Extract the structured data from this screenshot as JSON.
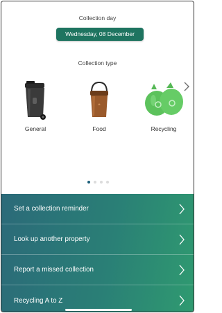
{
  "collection_day": {
    "label": "Collection day",
    "date": "Wednesday, 08 December"
  },
  "collection_type": {
    "label": "Collection type",
    "items": [
      {
        "label": "General",
        "icon": "general-waste-bin-icon",
        "color": "#3b3b3b"
      },
      {
        "label": "Food",
        "icon": "food-caddy-icon",
        "color": "#9a5a2b"
      },
      {
        "label": "Recycling",
        "icon": "recycling-bag-icon",
        "color": "#5cc25c"
      }
    ],
    "page_count": 4,
    "active_page": 1
  },
  "menu": {
    "items": [
      {
        "label": "Set a collection reminder"
      },
      {
        "label": "Look up another property"
      },
      {
        "label": "Report a missed collection"
      },
      {
        "label": "Recycling A to Z"
      }
    ]
  },
  "colors": {
    "accent": "#1e7460",
    "menu_gradient_start": "#2b6a79",
    "menu_gradient_end": "#2f9a70",
    "active_dot": "#1d5f7a"
  }
}
